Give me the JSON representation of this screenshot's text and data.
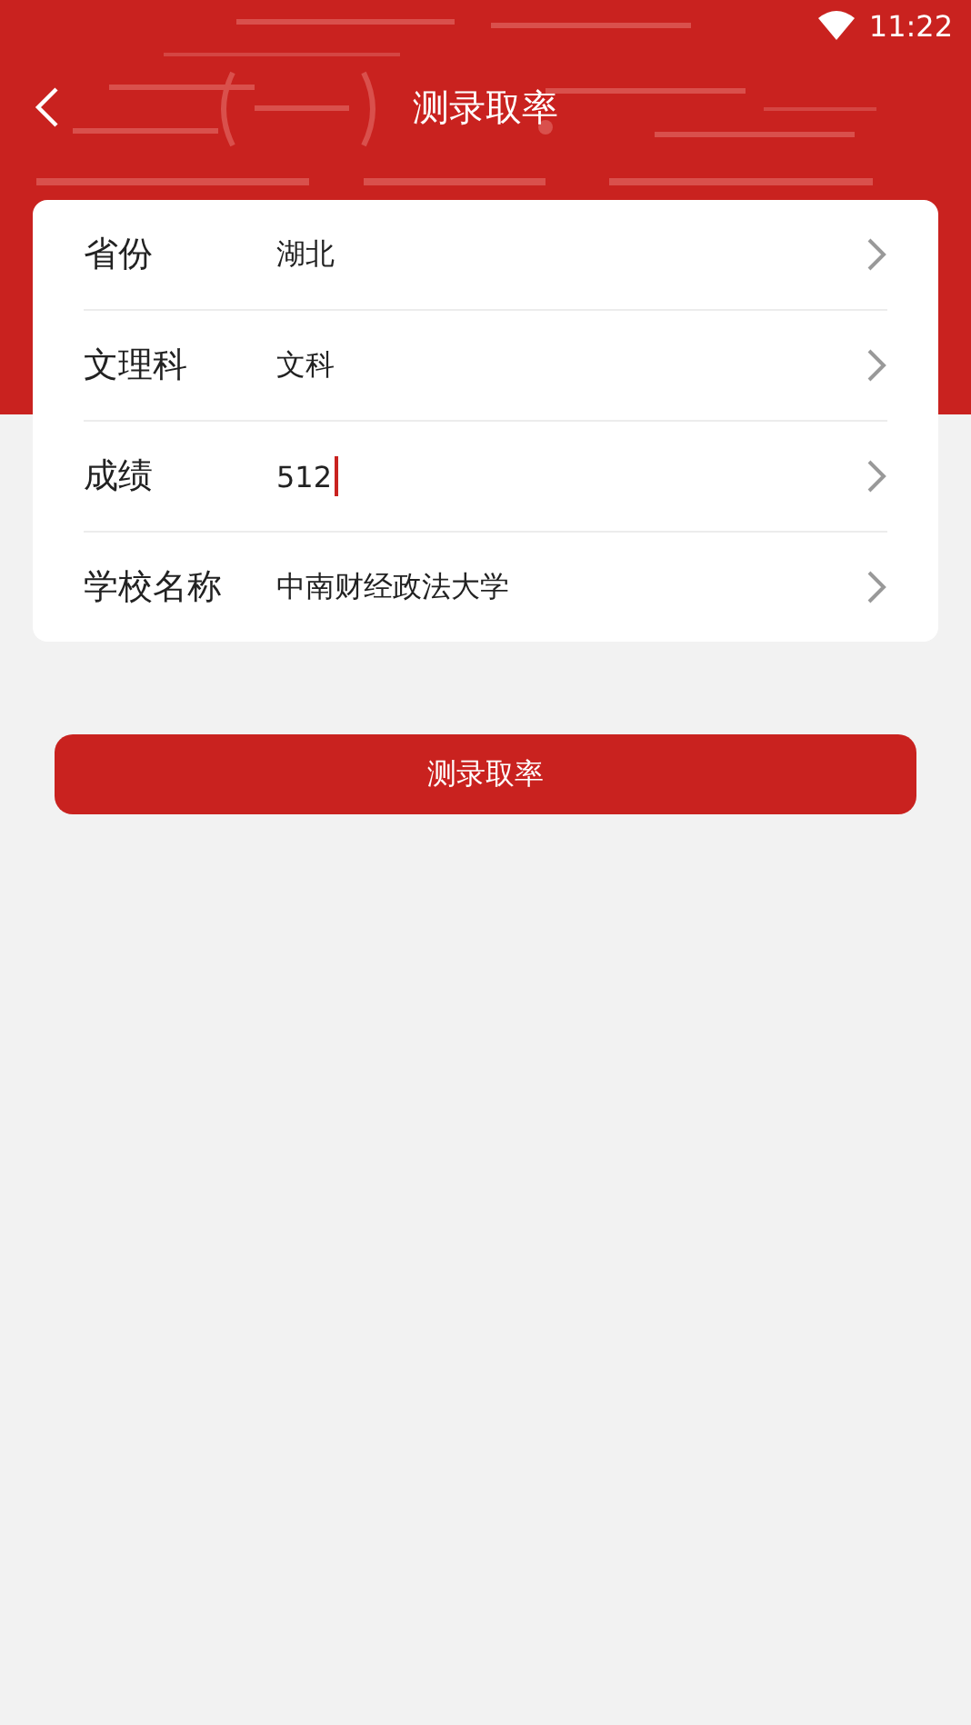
{
  "status_bar": {
    "time": "11:22"
  },
  "header": {
    "title": "测录取率"
  },
  "form_rows": [
    {
      "label": "省份",
      "value": "湖北",
      "focused": false
    },
    {
      "label": "文理科",
      "value": "文科",
      "focused": false
    },
    {
      "label": "成绩",
      "value": "512",
      "focused": true
    },
    {
      "label": "学校名称",
      "value": "中南财经政法大学",
      "focused": false
    }
  ],
  "submit_button": {
    "label": "测录取率"
  }
}
